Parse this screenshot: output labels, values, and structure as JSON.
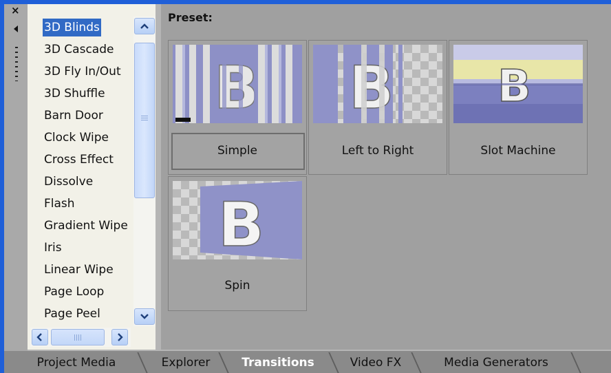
{
  "window": {
    "close_glyph": "×",
    "accent_color": "#316ac5",
    "frame_color": "#1f5fd8"
  },
  "transitions_list": {
    "items": [
      "3D Blinds",
      "3D Cascade",
      "3D Fly In/Out",
      "3D Shuffle",
      "Barn Door",
      "Clock Wipe",
      "Cross Effect",
      "Dissolve",
      "Flash",
      "Gradient Wipe",
      "Iris",
      "Linear Wipe",
      "Page Loop",
      "Page Peel"
    ],
    "selected": "3D Blinds"
  },
  "preset": {
    "label": "Preset:",
    "cards": [
      {
        "label": "Simple",
        "thumbnail": "blinds-thumbnail",
        "selected": true
      },
      {
        "label": "Left to Right",
        "thumbnail": "blinds-ltr-thumbnail",
        "selected": false
      },
      {
        "label": "Slot Machine",
        "thumbnail": "slot-machine-thumbnail",
        "selected": false
      },
      {
        "label": "Spin",
        "thumbnail": "spin-thumbnail",
        "selected": false
      }
    ],
    "thumbnail_letter": "B"
  },
  "tabs": [
    {
      "label": "Project Media",
      "active": false
    },
    {
      "label": "Explorer",
      "active": false
    },
    {
      "label": "Transitions",
      "active": true
    },
    {
      "label": "Video FX",
      "active": false
    },
    {
      "label": "Media Generators",
      "active": false
    }
  ]
}
